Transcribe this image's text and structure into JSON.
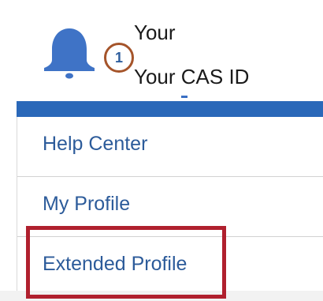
{
  "header": {
    "user_name": "Your",
    "cas_id_label": "Your CAS ID",
    "notification_count": "1",
    "bell_icon": "bell-icon"
  },
  "colors": {
    "accent_blue": "#2a68b9",
    "link_blue": "#2c5b9a",
    "badge_ring": "#a5542a",
    "highlight_red": "#b0202e"
  },
  "menu": {
    "items": [
      {
        "label": "Help Center"
      },
      {
        "label": "My Profile"
      },
      {
        "label": "Extended Profile"
      }
    ]
  }
}
